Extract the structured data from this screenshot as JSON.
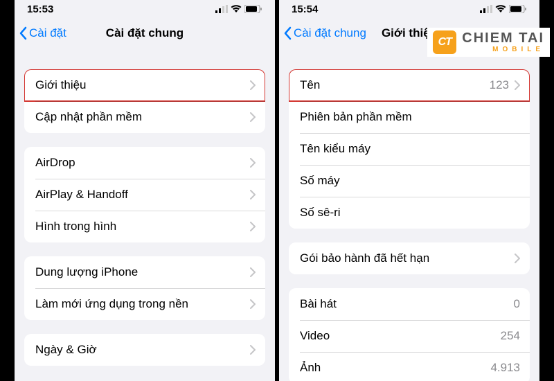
{
  "watermark": {
    "icon": "CT",
    "main": "CHIEM TAI",
    "sub": "MOBILE"
  },
  "left": {
    "status": {
      "time": "15:53"
    },
    "nav": {
      "back": "Cài đặt",
      "title": "Cài đặt chung"
    },
    "group1": [
      {
        "label": "Giới thiệu",
        "highlight": true,
        "chevron": true
      },
      {
        "label": "Cập nhật phần mềm",
        "chevron": true
      }
    ],
    "group2": [
      {
        "label": "AirDrop",
        "chevron": true
      },
      {
        "label": "AirPlay & Handoff",
        "chevron": true
      },
      {
        "label": "Hình trong hình",
        "chevron": true
      }
    ],
    "group3": [
      {
        "label": "Dung lượng iPhone",
        "chevron": true
      },
      {
        "label": "Làm mới ứng dụng trong nền",
        "chevron": true
      }
    ],
    "group4": [
      {
        "label": "Ngày & Giờ",
        "chevron": true
      }
    ]
  },
  "right": {
    "status": {
      "time": "15:54"
    },
    "nav": {
      "back": "Cài đặt chung",
      "title": "Giới thiệu"
    },
    "group1": [
      {
        "label": "Tên",
        "value": "123",
        "highlight": true,
        "chevron": true
      },
      {
        "label": "Phiên bản phần mềm"
      },
      {
        "label": "Tên kiểu máy"
      },
      {
        "label": "Số máy"
      },
      {
        "label": "Số sê-ri"
      }
    ],
    "group2": [
      {
        "label": "Gói bảo hành đã hết hạn",
        "chevron": true
      }
    ],
    "group3": [
      {
        "label": "Bài hát",
        "value": "0"
      },
      {
        "label": "Video",
        "value": "254"
      },
      {
        "label": "Ảnh",
        "value": "4.913"
      }
    ]
  }
}
